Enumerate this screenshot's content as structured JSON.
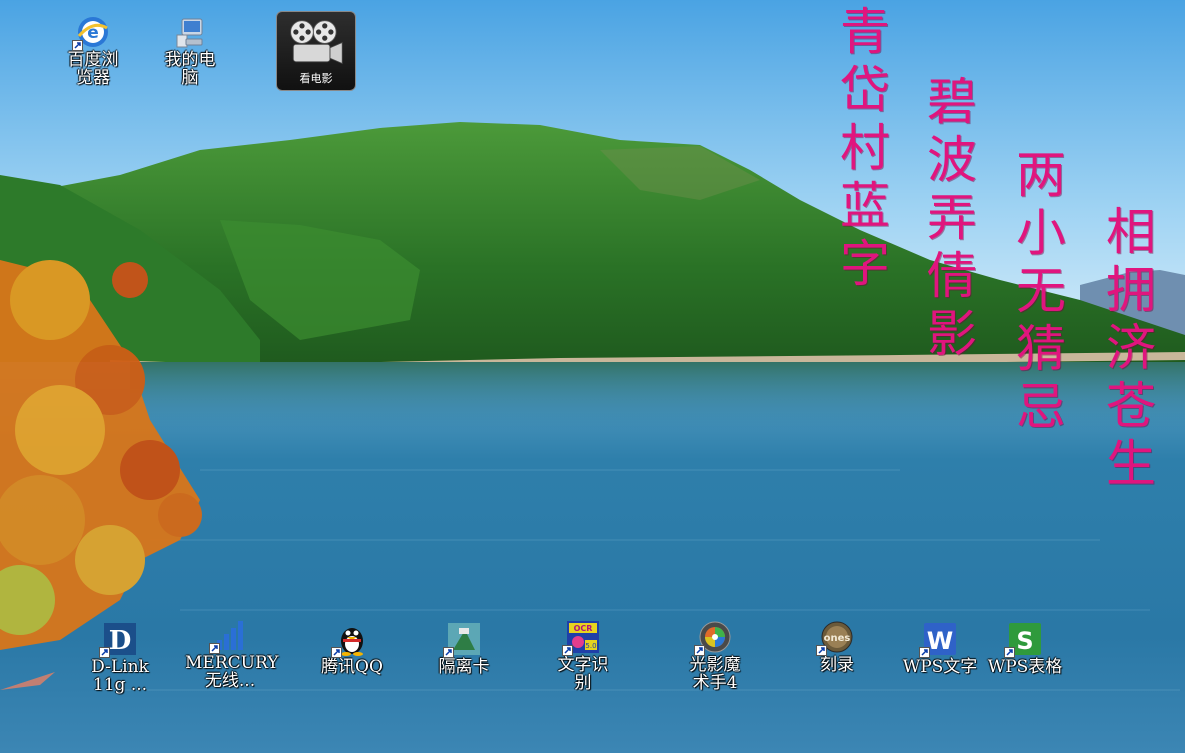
{
  "wallpaper": {
    "description_colors": {
      "sky_top": "#5aaee8",
      "sky_bottom": "#dff1fb",
      "water": "#2d7ea9",
      "hill": "#2f7d2c",
      "foliage": "#e07b1c"
    }
  },
  "top_icons": [
    {
      "id": "baidu",
      "label_lines": [
        "百度浏",
        "览器"
      ],
      "icon": "browser-icon"
    },
    {
      "id": "computer",
      "label_lines": [
        "我的电",
        "脑"
      ],
      "icon": "computer-icon"
    }
  ],
  "movie_icon": {
    "label": "看电影",
    "icon": "film-reel-icon"
  },
  "bottom_icons": [
    {
      "label_lines": [
        "D-Link",
        "11g ..."
      ],
      "icon": "dlink-icon"
    },
    {
      "label_lines": [
        "MERCURY",
        "无线..."
      ],
      "icon": "signal-bars-icon"
    },
    {
      "label_lines": [
        "腾讯QQ"
      ],
      "icon": "qq-penguin-icon"
    },
    {
      "label_lines": [
        "隔离卡"
      ],
      "icon": "isolation-card-icon"
    },
    {
      "label_lines": [
        "文字识",
        "别"
      ],
      "icon": "ocr-icon"
    },
    {
      "label_lines": [
        "光影魔",
        "术手4"
      ],
      "icon": "photo-lens-icon"
    },
    {
      "label_lines": [
        "刻录"
      ],
      "icon": "burn-disc-icon"
    },
    {
      "label_lines": [
        "WPS文字"
      ],
      "icon": "wps-writer-icon"
    },
    {
      "label_lines": [
        "WPS表格"
      ],
      "icon": "wps-spreadsheet-icon"
    }
  ],
  "poem": {
    "color": "#e0157e",
    "columns": [
      "青岱村蓝字",
      "碧波弄倩影",
      "两小无猜忌",
      "相拥济苍生"
    ]
  }
}
